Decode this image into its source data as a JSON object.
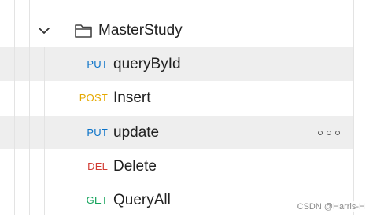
{
  "collection": {
    "folder": {
      "name": "MasterStudy",
      "icon": "folder-icon",
      "toggle_icon": "chevron-down-icon"
    },
    "requests": [
      {
        "method": "PUT",
        "name": "queryById",
        "method_color": "#0a72c8",
        "selected": true
      },
      {
        "method": "POST",
        "name": "Insert",
        "method_color": "#e5a800",
        "selected": false
      },
      {
        "method": "PUT",
        "name": "update",
        "method_color": "#0a72c8",
        "hovered": true,
        "more_icon": "more-options-icon"
      },
      {
        "method": "DEL",
        "name": "Delete",
        "method_color": "#d23b33",
        "selected": false
      },
      {
        "method": "GET",
        "name": "QueryAll",
        "method_color": "#14a35b",
        "selected": false
      }
    ]
  },
  "watermark": "CSDN @Harris-H"
}
